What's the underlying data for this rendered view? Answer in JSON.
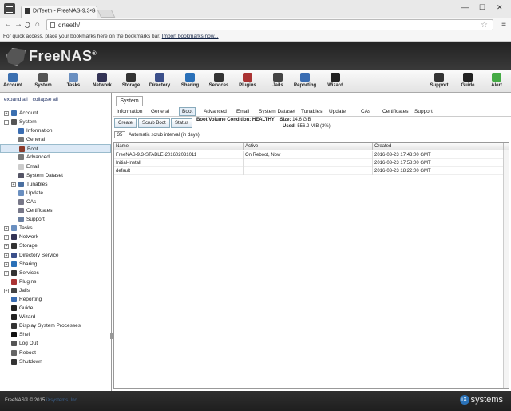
{
  "browser": {
    "tab_title": "DrTeeth - FreeNAS-9.3-S",
    "tab_close": "×",
    "url": "drteeth/",
    "bookmark_bar_text": "For quick access, place your bookmarks here on the bookmarks bar.",
    "bookmark_bar_link": "Import bookmarks now...",
    "nav": {
      "back": "←",
      "forward": "→",
      "reload": "C",
      "home": "⌂"
    },
    "star": "☆",
    "menu": "≡",
    "window_controls": [
      "—",
      "☐",
      "✕"
    ]
  },
  "app": {
    "logo_text": "FreeNAS",
    "logo_mark": "®"
  },
  "toolbar": [
    {
      "label": "Account",
      "color": "#3b6fb0"
    },
    {
      "label": "System",
      "color": "#555"
    },
    {
      "label": "Tasks",
      "color": "#6a8fc0"
    },
    {
      "label": "Network",
      "color": "#335"
    },
    {
      "label": "Storage",
      "color": "#333"
    },
    {
      "label": "Directory",
      "color": "#3b4f8a"
    },
    {
      "label": "Sharing",
      "color": "#2a70b8"
    },
    {
      "label": "Services",
      "color": "#333"
    },
    {
      "label": "Plugins",
      "color": "#a33"
    },
    {
      "label": "Jails",
      "color": "#444"
    },
    {
      "label": "Reporting",
      "color": "#3a6db2"
    },
    {
      "label": "Wizard",
      "color": "#222"
    },
    {
      "label": "Support",
      "color": "#333"
    },
    {
      "label": "Guide",
      "color": "#222"
    },
    {
      "label": "Alert",
      "color": "#4a4"
    }
  ],
  "sidebar": {
    "expand_all": "expand all",
    "collapse_all": "collapse all",
    "items": [
      {
        "label": "Account",
        "level": 0,
        "exp": "+",
        "color": "#3b6fb0"
      },
      {
        "label": "System",
        "level": 0,
        "exp": "−",
        "color": "#555"
      },
      {
        "label": "Information",
        "level": 1,
        "exp": "",
        "color": "#3a6db2"
      },
      {
        "label": "General",
        "level": 1,
        "exp": "",
        "color": "#777"
      },
      {
        "label": "Boot",
        "level": 1,
        "exp": "",
        "color": "#8a3a2a",
        "selected": true
      },
      {
        "label": "Advanced",
        "level": 1,
        "exp": "",
        "color": "#777"
      },
      {
        "label": "Email",
        "level": 1,
        "exp": "",
        "color": "#ccc"
      },
      {
        "label": "System Dataset",
        "level": 1,
        "exp": "",
        "color": "#556"
      },
      {
        "label": "Tunables",
        "level": 1,
        "exp": "+",
        "color": "#4a6fa0"
      },
      {
        "label": "Update",
        "level": 1,
        "exp": "",
        "color": "#6a8fc0"
      },
      {
        "label": "CAs",
        "level": 1,
        "exp": "",
        "color": "#778"
      },
      {
        "label": "Certificates",
        "level": 1,
        "exp": "",
        "color": "#778"
      },
      {
        "label": "Support",
        "level": 1,
        "exp": "",
        "color": "#6a7fa0"
      },
      {
        "label": "Tasks",
        "level": 0,
        "exp": "+",
        "color": "#6a8fc0"
      },
      {
        "label": "Network",
        "level": 0,
        "exp": "+",
        "color": "#335"
      },
      {
        "label": "Storage",
        "level": 0,
        "exp": "+",
        "color": "#333"
      },
      {
        "label": "Directory Service",
        "level": 0,
        "exp": "+",
        "color": "#3b4f8a"
      },
      {
        "label": "Sharing",
        "level": 0,
        "exp": "+",
        "color": "#2a70b8"
      },
      {
        "label": "Services",
        "level": 0,
        "exp": "+",
        "color": "#333"
      },
      {
        "label": "Plugins",
        "level": 0,
        "exp": "",
        "color": "#a33"
      },
      {
        "label": "Jails",
        "level": 0,
        "exp": "+",
        "color": "#444"
      },
      {
        "label": "Reporting",
        "level": 0,
        "exp": "",
        "color": "#3a6db2"
      },
      {
        "label": "Guide",
        "level": 0,
        "exp": "",
        "color": "#222"
      },
      {
        "label": "Wizard",
        "level": 0,
        "exp": "",
        "color": "#222"
      },
      {
        "label": "Display System Processes",
        "level": 0,
        "exp": "",
        "color": "#333"
      },
      {
        "label": "Shell",
        "level": 0,
        "exp": "",
        "color": "#111"
      },
      {
        "label": "Log Out",
        "level": 0,
        "exp": "",
        "color": "#555"
      },
      {
        "label": "Reboot",
        "level": 0,
        "exp": "",
        "color": "#666"
      },
      {
        "label": "Shutdown",
        "level": 0,
        "exp": "",
        "color": "#333"
      }
    ]
  },
  "main": {
    "tab": "System",
    "subtabs": [
      "Information",
      "General",
      "Boot",
      "Advanced",
      "Email",
      "System Dataset",
      "Tunables",
      "Update",
      "CAs",
      "Certificates",
      "Support"
    ],
    "active_subtab": "Boot",
    "buttons": [
      "Create",
      "Scrub Boot",
      "Status"
    ],
    "boot_status_label": "Boot Volume Condition:",
    "boot_status_value": "HEALTHY",
    "size_label": "Size:",
    "size_value": "14.6 GiB",
    "used_label": "Used:",
    "used_value": "556.2 MiB (3%)",
    "scrub_value": "35",
    "scrub_label": "Automatic scrub interval (in days)",
    "table": {
      "columns": [
        "Name",
        "Active",
        "Created"
      ],
      "rows": [
        [
          "FreeNAS-9.3-STABLE-201602031011",
          "On Reboot, Now",
          "2016-03-23 17:43:00 GMT"
        ],
        [
          "Initial-Install",
          "",
          "2016-03-23 17:58:00 GMT"
        ],
        [
          "default",
          "",
          "2016-03-23 18:22:00 GMT"
        ]
      ]
    }
  },
  "footer": {
    "copyright": "FreeNAS® © 2015",
    "version": "iXsystems, Inc.",
    "logo": "systems",
    "logo_mark": "iX"
  }
}
